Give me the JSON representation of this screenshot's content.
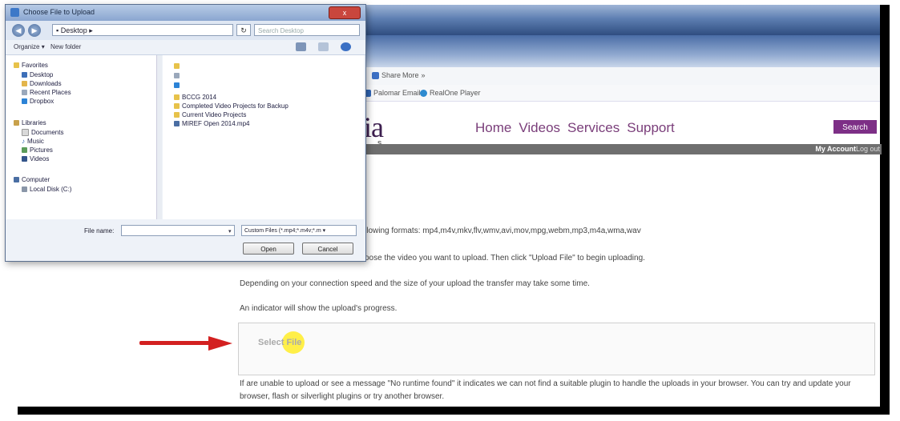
{
  "browser": {
    "toolbar_row1": [
      "Share",
      "More"
    ],
    "toolbar_row2": [
      "Palomar Email",
      "RealOne Player"
    ]
  },
  "site": {
    "logo": "dia",
    "logo_sub": "N S",
    "nav": [
      "Home",
      "Videos",
      "Services",
      "Support"
    ],
    "search_label": "Search",
    "account_label": "My Account",
    "logout_label": "Log out"
  },
  "content": {
    "line1": "llowing formats: mp4,m4v,mkv,flv,wmv,avi,mov,mpg,webm,mp3,m4a,wma,wav",
    "line2": "oose the video you want to upload. Then click \"Upload File\" to begin uploading.",
    "line3": "Depending on your connection speed and the size of your upload the transfer may take some time.",
    "line4": "An indicator will show the upload's progress.",
    "select_file": "Select File",
    "bottom_text": "If are unable to upload or see a message \"No runtime found\" it indicates we can not find a suitable plugin to handle the uploads in your browser. You can try and update your browser, flash or silverlight plugins or try another browser."
  },
  "dialog": {
    "title": "Choose File to Upload",
    "close": "x",
    "address": "Desktop",
    "search_placeholder": "Search Desktop",
    "organize": "Organize",
    "new_folder": "New folder",
    "nav": {
      "favorites": "Favorites",
      "favorites_items": [
        "Desktop",
        "Downloads",
        "Recent Places",
        "Dropbox"
      ],
      "libraries": "Libraries",
      "libraries_items": [
        "Documents",
        "Music",
        "Pictures",
        "Videos"
      ],
      "computer": "Computer",
      "computer_items": [
        "Local Disk (C:)"
      ]
    },
    "files": [
      "BCCG 2014",
      "Completed Video Projects for Backup",
      "Current Video Projects",
      "MIREF Open 2014.mp4"
    ],
    "filename_label": "File name:",
    "filter": "Custom Files (*.mp4;*.m4v;*.m",
    "open": "Open",
    "cancel": "Cancel"
  },
  "colors": {
    "accent_purple": "#7d2f86",
    "nav_purple": "#7a3e7a",
    "arrow_red": "#d32020",
    "highlight_yellow": "#ffec28"
  }
}
